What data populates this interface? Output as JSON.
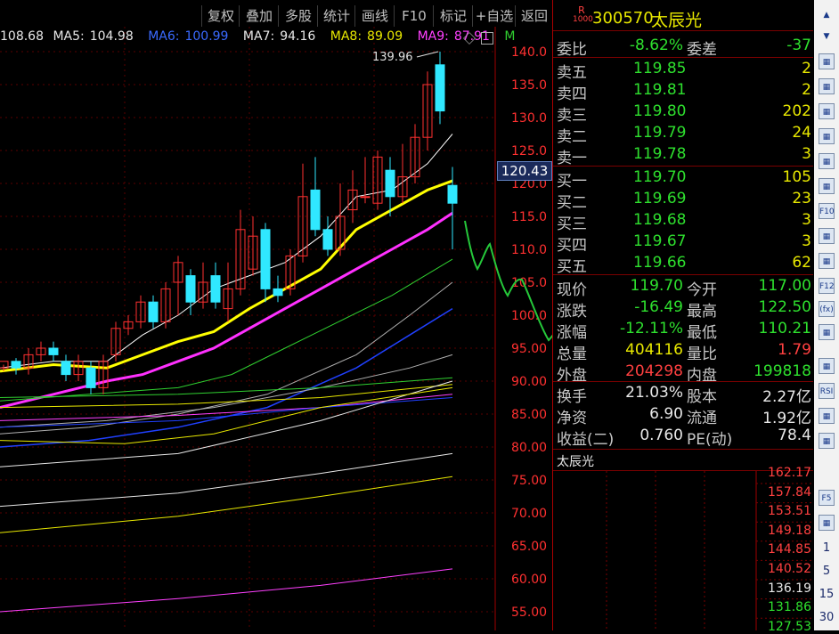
{
  "toolbar": {
    "items": [
      "复权",
      "叠加",
      "多股",
      "统计",
      "画线",
      "F10",
      "标记",
      "+自选",
      "返回"
    ]
  },
  "ma_line": {
    "first": "108.68",
    "ma5_label": "MA5:",
    "ma5": "104.98",
    "ma6_label": "MA6:",
    "ma6": "100.99",
    "ma7_label": "MA7:",
    "ma7": "94.16",
    "ma8_label": "MA8:",
    "ma8": "89.09",
    "ma9_label": "MA9:",
    "ma9": "87.91",
    "ma_tail": "M"
  },
  "chart": {
    "price_labels": [
      "140.0",
      "135.0",
      "130.0",
      "125.0",
      "120.0",
      "115.0",
      "110.0",
      "105.0",
      "100.0",
      "95.00",
      "90.00",
      "85.00",
      "80.00",
      "75.00",
      "70.00",
      "65.00",
      "60.00",
      "55.00"
    ],
    "high_marker": "139.96",
    "current_tag": "120.43",
    "colors": {
      "up": "#ff3030",
      "down": "#30e8ff",
      "ma5": "#ffffff",
      "ma10": "#ffff00",
      "ma20": "#ff30ff",
      "ma30": "#30d030",
      "ma60": "#2040ff",
      "grid": "#5a0000"
    }
  },
  "quote": {
    "badge_top": "R",
    "badge_bottom": "1000",
    "code": "300570",
    "name": "太辰光",
    "weibi_label": "委比",
    "weibi": "-8.62%",
    "weicha_label": "委差",
    "weicha": "-37",
    "asks": [
      {
        "label": "卖五",
        "price": "119.85",
        "vol": "2"
      },
      {
        "label": "卖四",
        "price": "119.81",
        "vol": "2"
      },
      {
        "label": "卖三",
        "price": "119.80",
        "vol": "202"
      },
      {
        "label": "卖二",
        "price": "119.79",
        "vol": "24"
      },
      {
        "label": "卖一",
        "price": "119.78",
        "vol": "3"
      }
    ],
    "bids": [
      {
        "label": "买一",
        "price": "119.70",
        "vol": "105"
      },
      {
        "label": "买二",
        "price": "119.69",
        "vol": "23"
      },
      {
        "label": "买三",
        "price": "119.68",
        "vol": "3"
      },
      {
        "label": "买四",
        "price": "119.67",
        "vol": "3"
      },
      {
        "label": "买五",
        "price": "119.66",
        "vol": "62"
      }
    ],
    "stats": [
      {
        "l1": "现价",
        "v1": "119.70",
        "c1": "green",
        "l2": "今开",
        "v2": "117.00",
        "c2": "green"
      },
      {
        "l1": "涨跌",
        "v1": "-16.49",
        "c1": "green",
        "l2": "最高",
        "v2": "122.50",
        "c2": "green"
      },
      {
        "l1": "涨幅",
        "v1": "-12.11%",
        "c1": "green",
        "l2": "最低",
        "v2": "110.21",
        "c2": "green"
      },
      {
        "l1": "总量",
        "v1": "404116",
        "c1": "yellow",
        "l2": "量比",
        "v2": "1.79",
        "c2": "red"
      },
      {
        "l1": "外盘",
        "v1": "204298",
        "c1": "red",
        "l2": "内盘",
        "v2": "199818",
        "c2": "green"
      }
    ],
    "fund": [
      {
        "l1": "换手",
        "v1": "21.03%",
        "l2": "股本",
        "v2": "2.27亿"
      },
      {
        "l1": "净资",
        "v1": "6.90",
        "l2": "流通",
        "v2": "1.92亿"
      },
      {
        "l1": "收益(二)",
        "v1": "0.760",
        "l2": "PE(动)",
        "v2": "78.4"
      }
    ],
    "mini_title": "太辰光",
    "mini_prices": [
      "162.17",
      "157.84",
      "153.51",
      "149.18",
      "144.85",
      "140.52",
      "136.19",
      "131.86",
      "127.53"
    ]
  },
  "iconbar": {
    "numbers": [
      "1",
      "5",
      "15",
      "30"
    ],
    "icons": [
      "chevron-up-icon",
      "chevron-down-icon",
      "list-icon",
      "bar-chart-icon",
      "k-line-icon",
      "line-chart-icon",
      "candle-icon",
      "table-icon",
      "f10-icon",
      "detail-icon",
      "news-icon",
      "f12-icon",
      "fx-icon",
      "refresh-icon",
      "volume-icon",
      "rsi-icon",
      "macd-icon",
      "tools-icon",
      "f5-icon",
      "cycle-icon"
    ],
    "labels": {
      "f10": "F10",
      "f12": "F12",
      "fx": "(fx)",
      "rsi": "RSI",
      "f5": "F5"
    }
  }
}
